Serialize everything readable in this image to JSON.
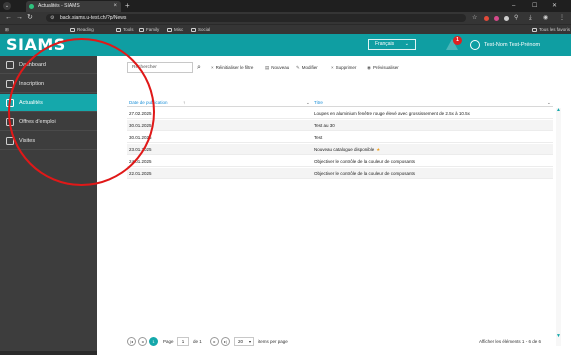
{
  "browser": {
    "tab_title": "Actualités - SIAMS",
    "url": "back.siams.u-test.ch/?p/News",
    "bookmarks": [
      "Reading",
      "Tools",
      "Family",
      "Misc",
      "Social"
    ],
    "bookmarks_right": "Tous les favoris"
  },
  "header": {
    "logo": "SIAMS",
    "language": "Français",
    "alert_count": "1",
    "user_name": "Test-Nom Test-Prénom"
  },
  "sidebar": {
    "items": [
      {
        "label": "Dashboard",
        "icon": "home-icon"
      },
      {
        "label": "Inscription",
        "icon": "form-icon"
      },
      {
        "label": "Actualités",
        "icon": "news-icon",
        "active": true
      },
      {
        "label": "Offres d'emploi",
        "icon": "briefcase-icon"
      },
      {
        "label": "Visites",
        "icon": "factory-icon"
      }
    ]
  },
  "toolbar": {
    "search_placeholder": "Rechercher",
    "reset_filter": "Réinitialiser le filtre",
    "new": "Nouveau",
    "edit": "Modifier",
    "delete": "Supprimer",
    "preview": "Prévisualiser"
  },
  "grid": {
    "columns": [
      "Date de publication",
      "Titre"
    ],
    "rows": [
      {
        "date": "27.02.2025",
        "title": "Loupes en aluminium fenêtre rouge élevé avec grossissement de 2.5x à 10.5x"
      },
      {
        "date": "30.01.2025",
        "title": "Test au 30"
      },
      {
        "date": "30.01.2025",
        "title": "Test"
      },
      {
        "date": "23.01.2025",
        "title": "Nouveau catalogue disponible",
        "starred": true
      },
      {
        "date": "24.01.2025",
        "title": "Objectiver le contrôle de la couleur de composants"
      },
      {
        "date": "22.01.2025",
        "title": "Objectiver le contrôle de la couleur de composants"
      }
    ]
  },
  "pager": {
    "page_label": "Page",
    "page_value": "1",
    "of_label": "de 1",
    "page_size": "20",
    "items_per_page": "items per page",
    "summary": "Afficher les éléments 1 - 6 de 6"
  },
  "colors": {
    "accent": "#15a8ab",
    "header": "#0f9ea2",
    "sidebar": "#3d3d3d",
    "annotation": "#e01818"
  }
}
